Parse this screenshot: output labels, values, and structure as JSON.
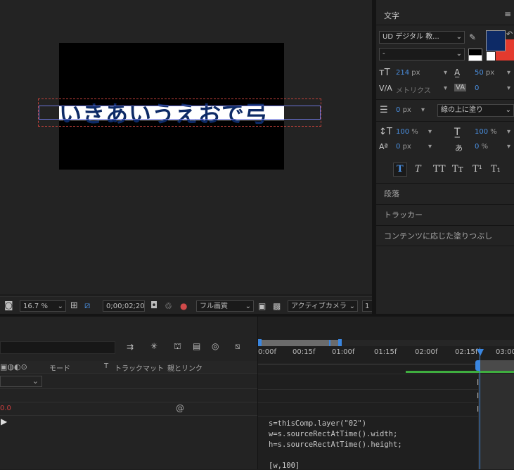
{
  "viewer": {
    "text_layer": "いきあいうえおで弓",
    "zoom": "16.7 %",
    "timecode": "0;00;02;20",
    "resolution": "フル画質",
    "camera": "アクティブカメラ",
    "views": "1"
  },
  "character_panel": {
    "title": "文字",
    "font_family": "UD デジタル 教...",
    "font_style": "-",
    "font_size": "214",
    "font_size_unit": "px",
    "leading": "50",
    "leading_unit": "px",
    "kerning": "メトリクス",
    "tracking": "0",
    "stroke_width": "0",
    "stroke_width_unit": "px",
    "stroke_option": "線の上に塗り",
    "vertical_scale": "100",
    "vertical_scale_unit": "%",
    "horizontal_scale": "100",
    "horizontal_scale_unit": "%",
    "baseline_shift": "0",
    "baseline_shift_unit": "px",
    "tsume": "0",
    "tsume_unit": "%",
    "styles": [
      "T",
      "T",
      "TT",
      "Tт",
      "T¹",
      "T₁"
    ],
    "fill_color": "#0d2a66",
    "stroke_color": "#e43a2e"
  },
  "sections": {
    "paragraph": "段落",
    "tracker": "トラッカー",
    "content_aware_fill": "コンテンツに応じた塗りつぶし"
  },
  "timeline": {
    "columns": {
      "mode": "モード",
      "t": "T",
      "trackmatte": "トラックマット",
      "parent": "親とリンク"
    },
    "ticks": [
      "0:00f",
      "00:15f",
      "01:00f",
      "01:15f",
      "02:00f",
      "02:15f",
      "03:00"
    ],
    "value_red": "0.0",
    "expression": [
      "s=thisComp.layer(\"02\")",
      "w=s.sourceRectAtTime().width;",
      "h=s.sourceRectAtTime().height;",
      "",
      "[w,100]"
    ]
  }
}
